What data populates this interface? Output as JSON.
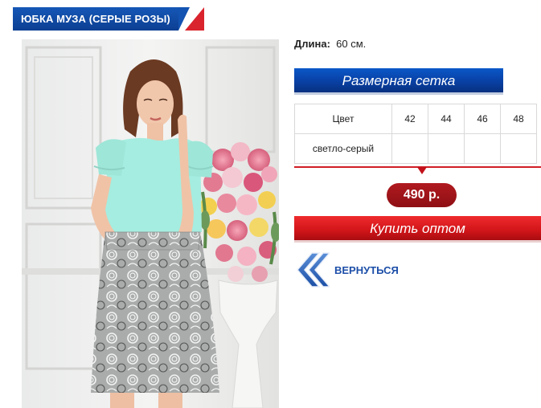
{
  "product": {
    "title": "ЮБКА МУЗА (СЕРЫЕ РОЗЫ)",
    "photo_alt_icon": "product-photo"
  },
  "specs": {
    "length_label": "Длина:",
    "length_value": "60 см."
  },
  "size_chart_button": {
    "label": "Размерная сетка"
  },
  "size_table": {
    "header": {
      "color_label": "Цвет",
      "sizes": [
        "42",
        "44",
        "46",
        "48"
      ]
    },
    "rows": [
      {
        "color": "светло-серый",
        "cells": [
          "",
          "",
          "",
          ""
        ]
      }
    ]
  },
  "price": {
    "value": "490 р."
  },
  "buy_button": {
    "label": "Купить оптом"
  },
  "back_link": {
    "label": "ВЕРНУТЬСЯ",
    "icon": "double-chevron-left-icon"
  },
  "colors": {
    "brand_blue": "#0d47a1",
    "accent_red": "#d11e26",
    "link_blue": "#1d4fa8"
  }
}
